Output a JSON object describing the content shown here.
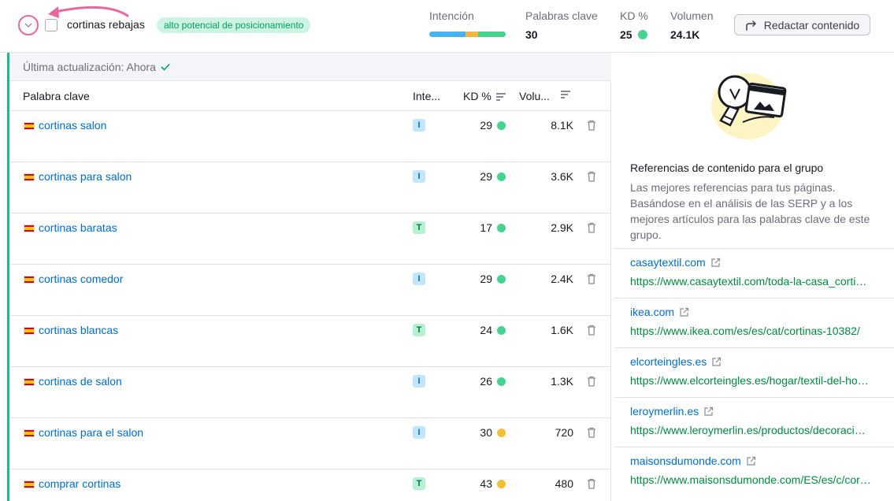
{
  "group": {
    "name": "cortinas rebajas",
    "badge": "alto potencial de posicionamiento"
  },
  "metrics": {
    "intent_label": "Intención",
    "keywords_label": "Palabras clave",
    "keywords_value": "30",
    "kd_label": "KD %",
    "kd_value": "25",
    "volume_label": "Volumen",
    "volume_value": "24.1K"
  },
  "intent_colors": [
    "#45b3f5",
    "#f4b63f",
    "#45d48f"
  ],
  "intent_shares": [
    0.47,
    0.17,
    0.36
  ],
  "write_button": "Redactar contenido",
  "update": {
    "text": "Última actualización: Ahora"
  },
  "table": {
    "headers": {
      "keyword": "Palabra clave",
      "intent": "Inte...",
      "kd": "KD %",
      "volume": "Volu..."
    },
    "rows": [
      {
        "keyword": "cortinas salon",
        "intent": "I",
        "kd": "29",
        "kd_color": "#45d48f",
        "volume": "8.1K"
      },
      {
        "keyword": "cortinas para salon",
        "intent": "I",
        "kd": "29",
        "kd_color": "#45d48f",
        "volume": "3.6K"
      },
      {
        "keyword": "cortinas baratas",
        "intent": "T",
        "kd": "17",
        "kd_color": "#45d48f",
        "volume": "2.9K"
      },
      {
        "keyword": "cortinas comedor",
        "intent": "I",
        "kd": "29",
        "kd_color": "#45d48f",
        "volume": "2.4K"
      },
      {
        "keyword": "cortinas blancas",
        "intent": "T",
        "kd": "24",
        "kd_color": "#45d48f",
        "volume": "1.6K"
      },
      {
        "keyword": "cortinas de salon",
        "intent": "I",
        "kd": "26",
        "kd_color": "#45d48f",
        "volume": "1.3K"
      },
      {
        "keyword": "cortinas para el salon",
        "intent": "I",
        "kd": "30",
        "kd_color": "#f4c032",
        "volume": "720"
      },
      {
        "keyword": "comprar cortinas",
        "intent": "T",
        "kd": "43",
        "kd_color": "#f4c032",
        "volume": "480"
      }
    ]
  },
  "references": {
    "title": "Referencias de contenido para el grupo",
    "description": "Las mejores referencias para tus páginas. Basándose en el análisis de las SERP y a los mejores artículos para las palabras clave de este grupo.",
    "items": [
      {
        "domain": "casaytextil.com",
        "url": "https://www.casaytextil.com/toda-la-casa_cortinas"
      },
      {
        "domain": "ikea.com",
        "url": "https://www.ikea.com/es/es/cat/cortinas-10382/"
      },
      {
        "domain": "elcorteingles.es",
        "url": "https://www.elcorteingles.es/hogar/textil-del-hogar/cortinas/"
      },
      {
        "domain": "leroymerlin.es",
        "url": "https://www.leroymerlin.es/productos/decoracion/cortinas"
      },
      {
        "domain": "maisonsdumonde.com",
        "url": "https://www.maisonsdumonde.com/ES/es/c/cortinas"
      }
    ]
  }
}
